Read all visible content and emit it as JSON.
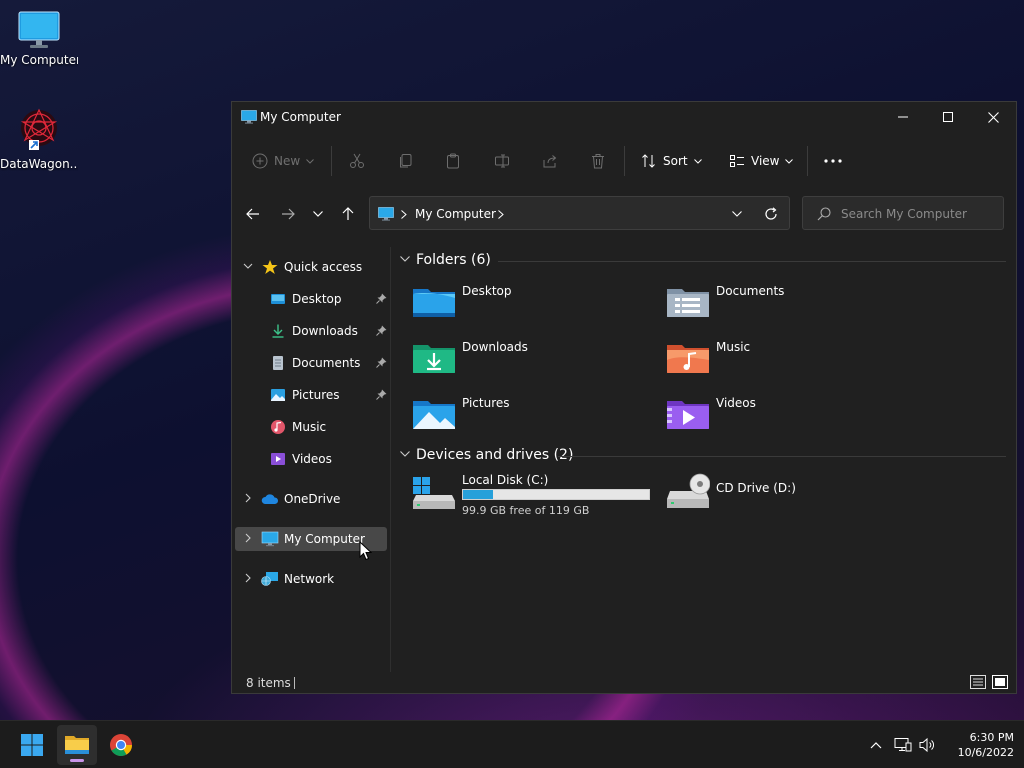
{
  "desktop": {
    "icons": [
      {
        "label": "My Computer",
        "icon": "monitor-icon"
      },
      {
        "label": "DataWagon...",
        "icon": "datawagon-shortcut-icon"
      }
    ]
  },
  "window": {
    "title": "My Computer",
    "controls": {
      "minimize": "minimize-icon",
      "maximize": "maximize-icon",
      "close": "close-icon"
    }
  },
  "toolbar": {
    "new_label": "New",
    "sort_label": "Sort",
    "view_label": "View",
    "more_icon": "more-dots-icon",
    "actions": [
      "cut-icon",
      "copy-icon",
      "paste-icon",
      "rename-icon",
      "share-icon",
      "delete-icon"
    ]
  },
  "address": {
    "crumb": "My Computer",
    "search_placeholder": "Search My Computer"
  },
  "navpane": {
    "quick_access": "Quick access",
    "items": [
      {
        "label": "Desktop",
        "pinned": true
      },
      {
        "label": "Downloads",
        "pinned": true
      },
      {
        "label": "Documents",
        "pinned": true
      },
      {
        "label": "Pictures",
        "pinned": true
      },
      {
        "label": "Music",
        "pinned": false
      },
      {
        "label": "Videos",
        "pinned": false
      }
    ],
    "onedrive": "OneDrive",
    "mycomputer": "My Computer",
    "network": "Network"
  },
  "content": {
    "folders_header": "Folders (6)",
    "folders": [
      {
        "label": "Desktop"
      },
      {
        "label": "Documents"
      },
      {
        "label": "Downloads"
      },
      {
        "label": "Music"
      },
      {
        "label": "Pictures"
      },
      {
        "label": "Videos"
      }
    ],
    "devices_header": "Devices and drives (2)",
    "drives": [
      {
        "label": "Local Disk (C:)",
        "free_text": "99.9 GB free of 119 GB",
        "used_fraction": 0.16
      },
      {
        "label": "CD Drive (D:)"
      }
    ]
  },
  "status": {
    "count": "8 items"
  },
  "taskbar": {
    "time": "6:30 PM",
    "date": "10/6/2022"
  },
  "colors": {
    "window_bg": "#202020",
    "accent": "#26a0da",
    "selected": "#484848",
    "taskbar": "#1c1c1c"
  }
}
